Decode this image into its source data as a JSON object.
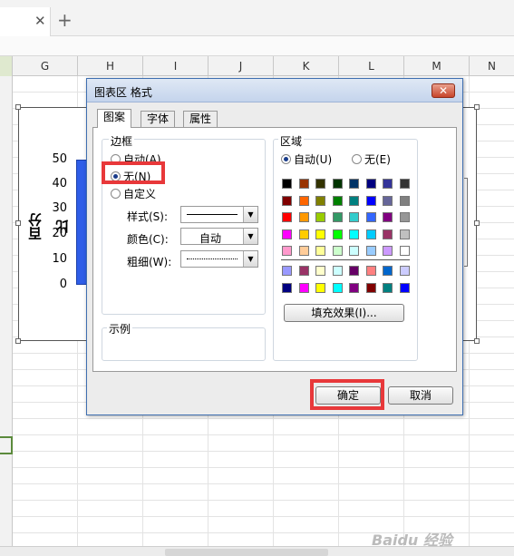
{
  "tabs": {
    "close_glyph": "✕",
    "add_glyph": "+"
  },
  "columns": [
    "G",
    "H",
    "I",
    "J",
    "K",
    "L",
    "M",
    "N"
  ],
  "chart": {
    "y_axis_label": "百分比",
    "y_ticks": [
      "50",
      "40",
      "30",
      "20",
      "10",
      "0"
    ],
    "bar_color": "#2f5ee8"
  },
  "dialog": {
    "title": "图表区 格式",
    "close_glyph": "✕",
    "tabs": {
      "pattern": "图案",
      "font": "字体",
      "property": "属性"
    },
    "border": {
      "group_label": "边框",
      "options": {
        "auto": "自动(A)",
        "none": "无(N)",
        "custom": "自定义"
      },
      "selected": "none",
      "style_label": "样式(S):",
      "color_label": "颜色(C):",
      "color_value": "自动",
      "weight_label": "粗细(W):"
    },
    "sample_label": "示例",
    "area": {
      "group_label": "区域",
      "options": {
        "auto": "自动(U)",
        "none": "无(E)"
      },
      "selected": "auto",
      "fill_effects_button": "填充效果(I)..."
    },
    "ok_button": "确定",
    "cancel_button": "取消",
    "palette_main": [
      [
        "#000000",
        "#993300",
        "#333300",
        "#003300",
        "#003366",
        "#000080",
        "#333399",
        "#333333"
      ],
      [
        "#800000",
        "#ff6600",
        "#808000",
        "#008000",
        "#008080",
        "#0000ff",
        "#666699",
        "#808080"
      ],
      [
        "#ff0000",
        "#ff9900",
        "#99cc00",
        "#339966",
        "#33cccc",
        "#3366ff",
        "#800080",
        "#969696"
      ],
      [
        "#ff00ff",
        "#ffcc00",
        "#ffff00",
        "#00ff00",
        "#00ffff",
        "#00ccff",
        "#993366",
        "#c0c0c0"
      ],
      [
        "#ff99cc",
        "#ffcc99",
        "#ffff99",
        "#ccffcc",
        "#ccffff",
        "#99ccff",
        "#cc99ff",
        "#ffffff"
      ]
    ],
    "palette_extra": [
      [
        "#9999ff",
        "#993366",
        "#ffffcc",
        "#ccffff",
        "#660066",
        "#ff8080",
        "#0066cc",
        "#ccccff"
      ],
      [
        "#000080",
        "#ff00ff",
        "#ffff00",
        "#00ffff",
        "#800080",
        "#800000",
        "#008080",
        "#0000ff"
      ]
    ]
  },
  "watermark": "Baidu 经验"
}
